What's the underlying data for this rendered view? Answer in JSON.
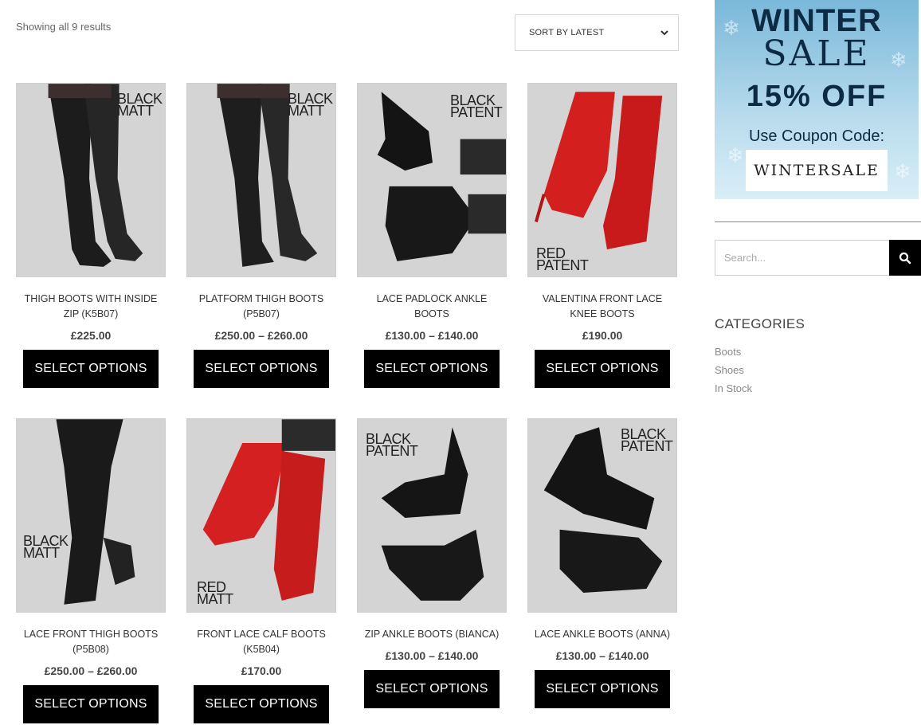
{
  "results": {
    "count_text": "Showing all 9 results"
  },
  "sort": {
    "label": "SORT BY LATEST"
  },
  "products": [
    {
      "title": "THIGH BOOTS WITH INSIDE ZIP (K5B07)",
      "price": "£225.00",
      "tag": "BLACK\nMATT",
      "button": "SELECT OPTIONS"
    },
    {
      "title": "PLATFORM THIGH BOOTS (P5B07)",
      "price": "£250.00 – £260.00",
      "tag": "BLACK\nMATT",
      "button": "SELECT OPTIONS"
    },
    {
      "title": "LACE PADLOCK ANKLE BOOTS",
      "price": "£130.00 – £140.00",
      "tag": "BLACK\nPATENT",
      "button": "SELECT OPTIONS"
    },
    {
      "title": "VALENTINA FRONT LACE KNEE BOOTS",
      "price": "£190.00",
      "tag": "RED\nPATENT",
      "button": "SELECT OPTIONS"
    },
    {
      "title": "LACE FRONT THIGH BOOTS (P5B08)",
      "price": "£250.00 – £260.00",
      "tag": "BLACK\nMATT",
      "button": "SELECT OPTIONS"
    },
    {
      "title": "FRONT LACE CALF BOOTS (K5B04)",
      "price": "£170.00",
      "tag": "RED\nMATT",
      "button": "SELECT OPTIONS"
    },
    {
      "title": "ZIP ANKLE BOOTS (BIANCA)",
      "price": "£130.00 – £140.00",
      "tag": "BLACK\nPATENT",
      "button": "SELECT OPTIONS"
    },
    {
      "title": "LACE ANKLE BOOTS (ANNA)",
      "price": "£130.00 – £140.00",
      "tag": "BLACK\nPATENT",
      "button": "SELECT OPTIONS"
    }
  ],
  "promo": {
    "line1": "WINTER",
    "line2": "SALE",
    "line3": "15% OFF",
    "line4": "Use Coupon Code:",
    "code": "WINTERSALE"
  },
  "search": {
    "placeholder": "Search..."
  },
  "categories": {
    "title": "CATEGORIES",
    "items": [
      "Boots",
      "Shoes",
      "In Stock"
    ]
  },
  "colors": {
    "button_bg": "#000000",
    "boot_black": "#1a1a1a",
    "boot_red": "#d41f1f",
    "promo_text": "#0d2a44"
  }
}
